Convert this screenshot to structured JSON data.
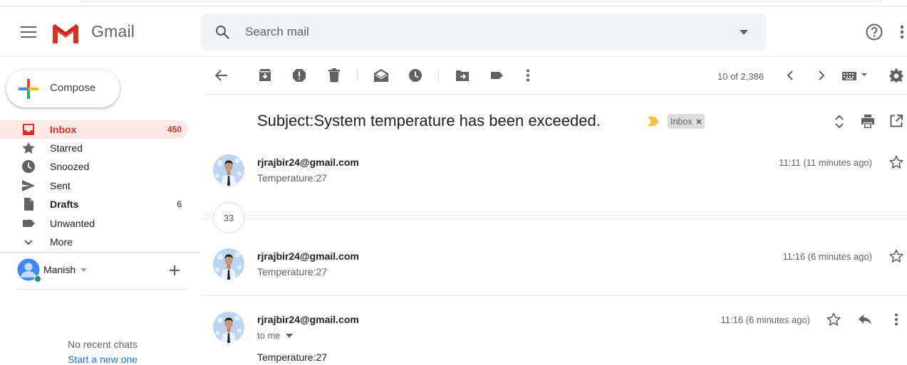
{
  "app": {
    "name": "Gmail"
  },
  "search": {
    "placeholder": "Search mail"
  },
  "compose": {
    "label": "Compose"
  },
  "sidebar": {
    "items": [
      {
        "label": "Inbox",
        "count": "450"
      },
      {
        "label": "Starred",
        "count": ""
      },
      {
        "label": "Snoozed",
        "count": ""
      },
      {
        "label": "Sent",
        "count": ""
      },
      {
        "label": "Drafts",
        "count": "6"
      },
      {
        "label": "Unwanted",
        "count": ""
      },
      {
        "label": "More",
        "count": ""
      }
    ]
  },
  "hangouts": {
    "user": "Manish",
    "no_chats": "No recent chats",
    "start_new": "Start a new one"
  },
  "toolbar": {
    "pagination": "10 of 2,386"
  },
  "thread": {
    "subject": "Subject:System temperature has been exceeded.",
    "label_chip": "Inbox",
    "collapsed_count": "33",
    "messages": [
      {
        "sender": "rjrajbir24@gmail.com",
        "snippet": "Temperature:27",
        "time": "11:11 (11 minutes ago)"
      },
      {
        "sender": "rjrajbir24@gmail.com",
        "snippet": "Temperature:27",
        "time": "11:16 (6 minutes ago)"
      },
      {
        "sender": "rjrajbir24@gmail.com",
        "recipient": "to me",
        "body": "Temperature:27",
        "time": "11:16 (6 minutes ago)"
      }
    ]
  },
  "colors": {
    "accent_red": "#d93025",
    "active_bg": "#fce8e6",
    "label_chevron": "#f6c343",
    "online": "#0f9d58"
  }
}
